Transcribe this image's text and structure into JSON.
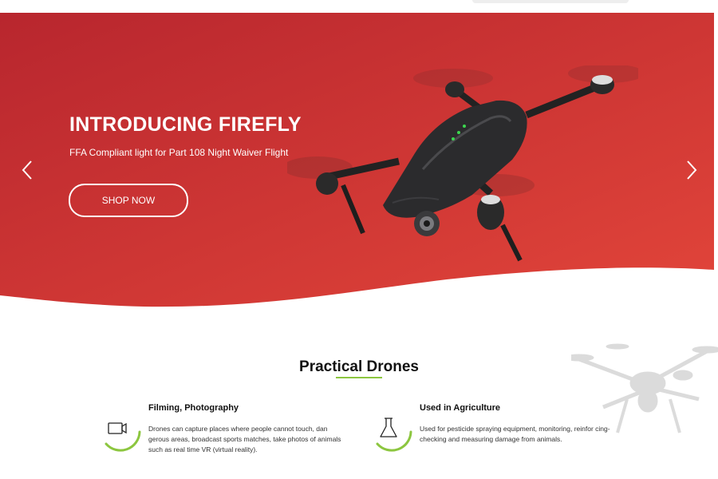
{
  "hero": {
    "title": "INTRODUCING FIREFLY",
    "subtitle": "FFA Compliant light for Part 108 Night Waiver Flight",
    "cta_label": "SHOP NOW",
    "gradient_colors": [
      "#b8262e",
      "#e2453a"
    ],
    "prev_icon": "chevron-left-icon",
    "next_icon": "chevron-right-icon"
  },
  "section": {
    "title": "Practical Drones",
    "accent_color": "#8cc63f"
  },
  "features": [
    {
      "icon": "video-camera-icon",
      "title": "Filming, Photography",
      "text": "Drones can capture places where people cannot touch, dan gerous areas, broadcast sports matches, take photos of animals such as real time VR (virtual reality)."
    },
    {
      "icon": "flask-icon",
      "title": "Used in Agriculture",
      "text": "Used for pesticide spraying equipment, monitoring, reinfor cing-checking and measuring damage from animals."
    }
  ]
}
